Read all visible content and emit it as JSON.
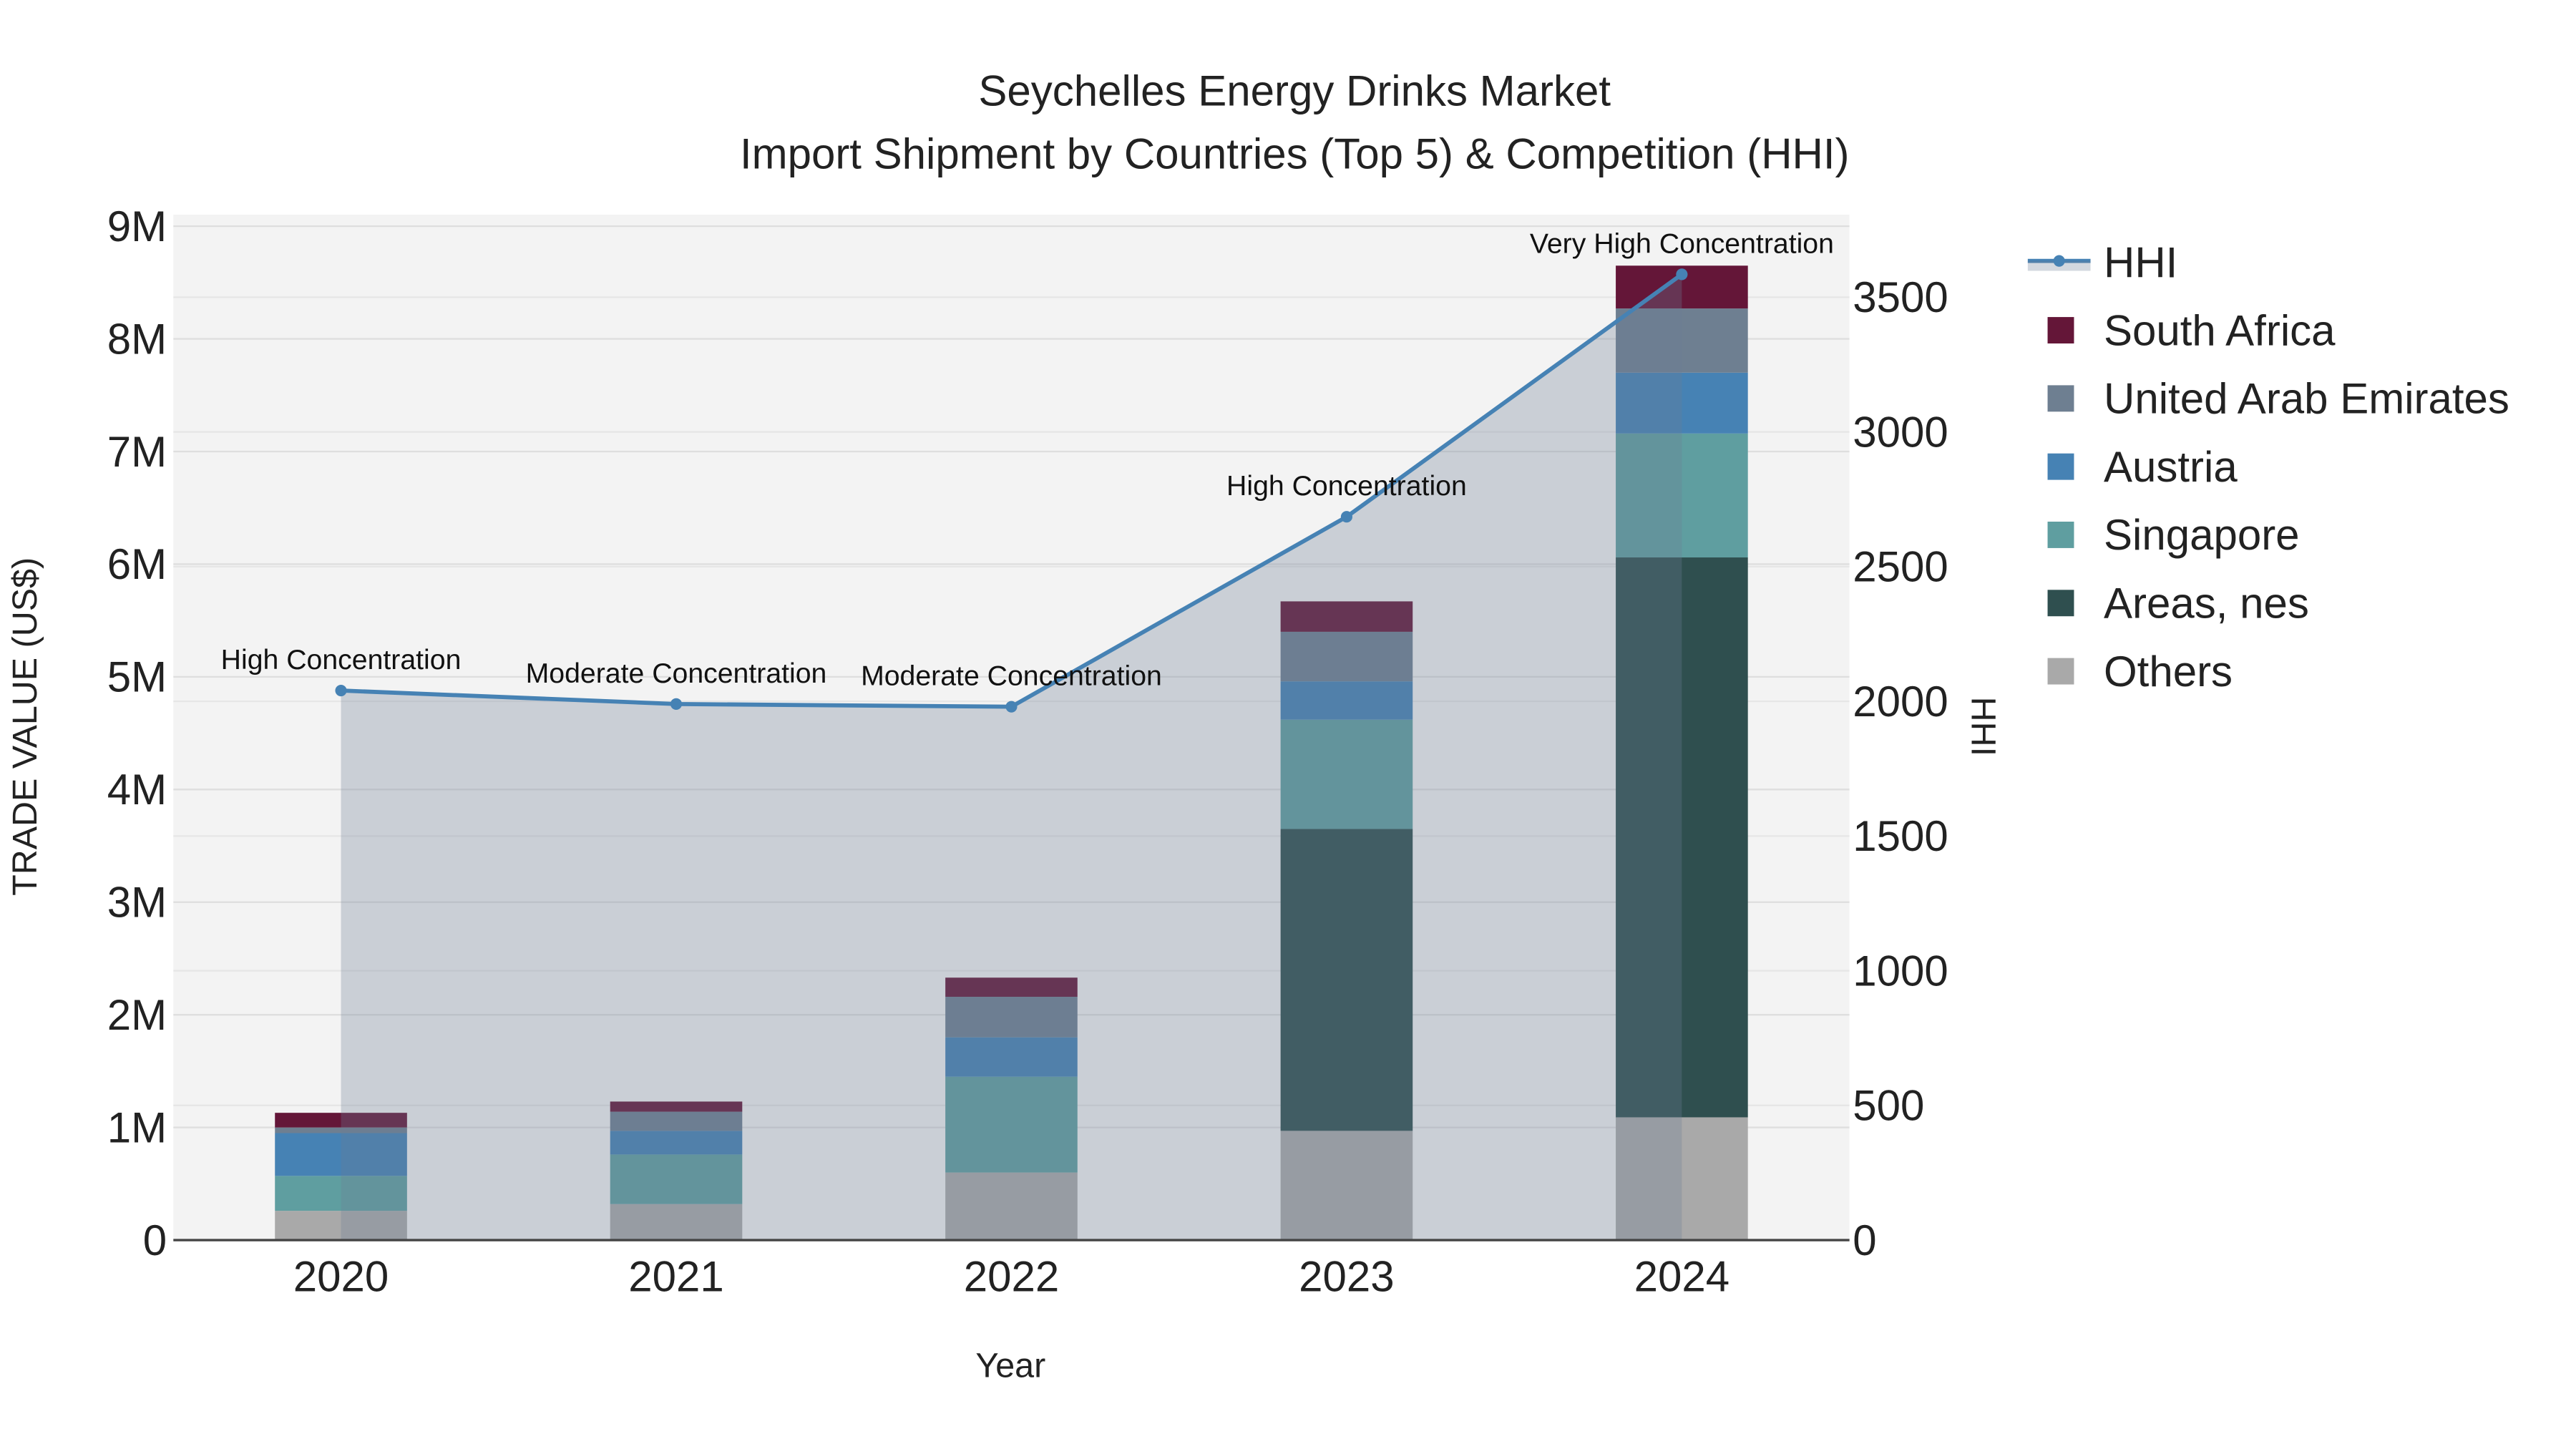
{
  "chart_data": {
    "type": "bar",
    "title": "Seychelles Energy Drinks Market",
    "subtitle": "Import Shipment by Countries (Top 5) & Competition (HHI)",
    "xlabel": "Year",
    "ylabel": "TRADE VALUE (US$)",
    "y2label": "HHI",
    "categories": [
      "2020",
      "2021",
      "2022",
      "2023",
      "2024"
    ],
    "ylim": [
      0,
      9000000
    ],
    "y2lim": [
      0,
      3800
    ],
    "yticks": [
      {
        "v": 0,
        "t": "0"
      },
      {
        "v": 1000000,
        "t": "1M"
      },
      {
        "v": 2000000,
        "t": "2M"
      },
      {
        "v": 3000000,
        "t": "3M"
      },
      {
        "v": 4000000,
        "t": "4M"
      },
      {
        "v": 5000000,
        "t": "5M"
      },
      {
        "v": 6000000,
        "t": "6M"
      },
      {
        "v": 7000000,
        "t": "7M"
      },
      {
        "v": 8000000,
        "t": "8M"
      },
      {
        "v": 9000000,
        "t": "9M"
      }
    ],
    "y2ticks": [
      0,
      500,
      1000,
      1500,
      2000,
      2500,
      3000,
      3500
    ],
    "grid": true,
    "legend_position": "right",
    "stacked": true,
    "series": [
      {
        "name": "Others",
        "color": "#a9a9a9",
        "values": [
          260000,
          320000,
          600000,
          970000,
          1090000
        ]
      },
      {
        "name": "Areas, nes",
        "color": "#2f4f4f",
        "values": [
          0,
          0,
          0,
          2680000,
          4970000
        ]
      },
      {
        "name": "Singapore",
        "color": "#5f9ea0",
        "values": [
          310000,
          440000,
          850000,
          970000,
          1100000
        ]
      },
      {
        "name": "Austria",
        "color": "#4682b4",
        "values": [
          380000,
          210000,
          350000,
          340000,
          540000
        ]
      },
      {
        "name": "United Arab Emirates",
        "color": "#6e7f91",
        "values": [
          50000,
          170000,
          360000,
          440000,
          570000
        ]
      },
      {
        "name": "South Africa",
        "color": "#641638",
        "values": [
          130000,
          90000,
          170000,
          270000,
          380000
        ]
      }
    ],
    "line": {
      "name": "HHI",
      "color": "#4682b4",
      "values": [
        2040,
        1990,
        1980,
        2685,
        3585
      ],
      "annotations": [
        "High Concentration",
        "Moderate Concentration",
        "Moderate Concentration",
        "High Concentration",
        "Very High Concentration"
      ]
    }
  }
}
